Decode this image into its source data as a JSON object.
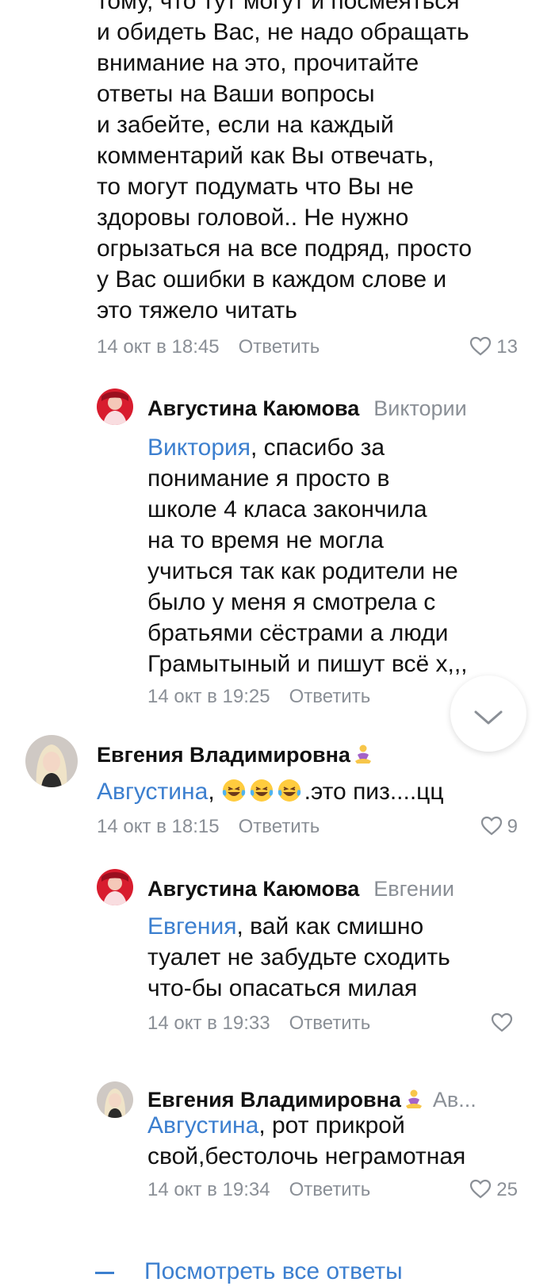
{
  "comments": [
    {
      "text_lines": [
        "тому, что тут могут и посмеяться",
        "и обидеть Вас, не надо обращать",
        "внимание на это, прочитайте",
        "ответы на Ваши вопросы",
        "и забейте, если на каждый",
        "комментарий как Вы отвечать,",
        "то могут подумать что Вы не",
        "здоровы головой.. Не нужно",
        "огрызаться на все подряд, просто",
        "у Вас ошибки в каждом слове и",
        "это тяжело читать"
      ],
      "timestamp": "14 окт в 18:45",
      "reply_label": "Ответить",
      "likes": "13"
    },
    {
      "author": "Августина Каюмова",
      "reply_to": "Виктории",
      "mention": "Виктория",
      "first_line_rest": ", спасибо за",
      "text_lines": [
        "понимание я просто в",
        "школе 4 класа закончила",
        "на то время не могла",
        "учиться так как родители не",
        "было у меня я смотрела с",
        "братьями сёстрами а люди",
        "Грамытыный и пишут всё х,,,"
      ],
      "timestamp": "14 окт в 19:25",
      "reply_label": "Ответить"
    },
    {
      "author": "Евгения Владимировна",
      "mention": "Августина",
      "comma": ",",
      "first_line_rest": ".это пиз....цц",
      "timestamp": "14 окт в 18:15",
      "reply_label": "Ответить",
      "likes": "9"
    },
    {
      "author": "Августина Каюмова",
      "reply_to": "Евгении",
      "mention": "Евгения",
      "first_line_rest": ", вай как смишно",
      "text_lines": [
        "туалет не забудьте сходить",
        "что-бы опасаться милая"
      ],
      "timestamp": "14 окт в 19:33",
      "reply_label": "Ответить"
    },
    {
      "author": "Евгения Владимировна",
      "reply_to": "Ав...",
      "mention": "Августина",
      "first_line_rest": ", рот прикрой",
      "text_lines": [
        "свой,бестолочь неграмотная"
      ],
      "timestamp": "14 окт в 19:34",
      "reply_label": "Ответить",
      "likes": "25"
    }
  ],
  "view_all_label": "Посмотреть все ответы",
  "colors": {
    "link_blue": "#3c7fcf",
    "meta_grey": "#8a8f96",
    "text": "#111111"
  },
  "icons": {
    "like": "heart-outline-icon",
    "emoji": "laughing-crying-emoji",
    "title_emoji": "person-in-lotus-position-emoji",
    "scroll_down": "chevron-down-icon"
  }
}
